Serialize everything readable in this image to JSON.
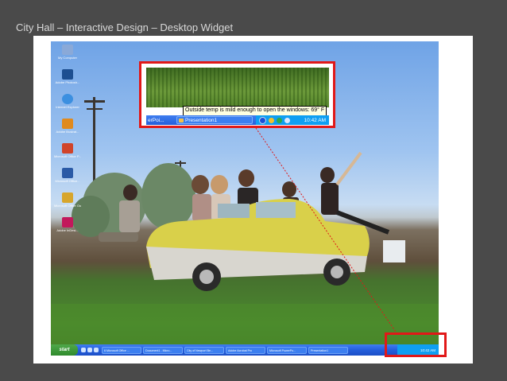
{
  "slide": {
    "title": "City Hall – Interactive Design – Desktop Widget"
  },
  "desktop": {
    "icons": [
      {
        "label": "My Computer",
        "icon": "computer-icon",
        "color": "#8aa9d8"
      },
      {
        "label": "Adobe Photosh...",
        "icon": "photoshop-icon",
        "color": "#1d4f91"
      },
      {
        "label": "Internet Explorer",
        "icon": "ie-icon",
        "color": "#3b8fe0"
      },
      {
        "label": "Adobe Illustrat...",
        "icon": "illustrator-icon",
        "color": "#e08a1e"
      },
      {
        "label": "Microsoft Office P...",
        "icon": "office-icon",
        "color": "#d0442a"
      },
      {
        "label": "Microsoft Office...",
        "icon": "word-icon",
        "color": "#2a5aa6"
      },
      {
        "label": "Microsoft Office Outlook",
        "icon": "outlook-icon",
        "color": "#d7a62d"
      },
      {
        "label": "Adobe InDesi...",
        "icon": "indesign-icon",
        "color": "#c2185b"
      }
    ],
    "taskbar": {
      "start_label": "start",
      "buttons": [
        "6 Microsoft Office ...",
        "Document1 - Micro...",
        "City of Newport Be...",
        "Adobe Acrobat Pro",
        "Microsoft PowerPo...",
        "Presentation1"
      ],
      "clock": "10:42 AM"
    }
  },
  "zoom": {
    "tooltip": "Outside temp is mild enough to open the windows: 69° F",
    "taskbar_left": "erPoi...",
    "presentation_button": "Presentation1",
    "clock": "10:42 AM"
  },
  "colors": {
    "highlight": "#e11818",
    "taskbar": "#245edb",
    "tray": "#0f9ff2"
  }
}
